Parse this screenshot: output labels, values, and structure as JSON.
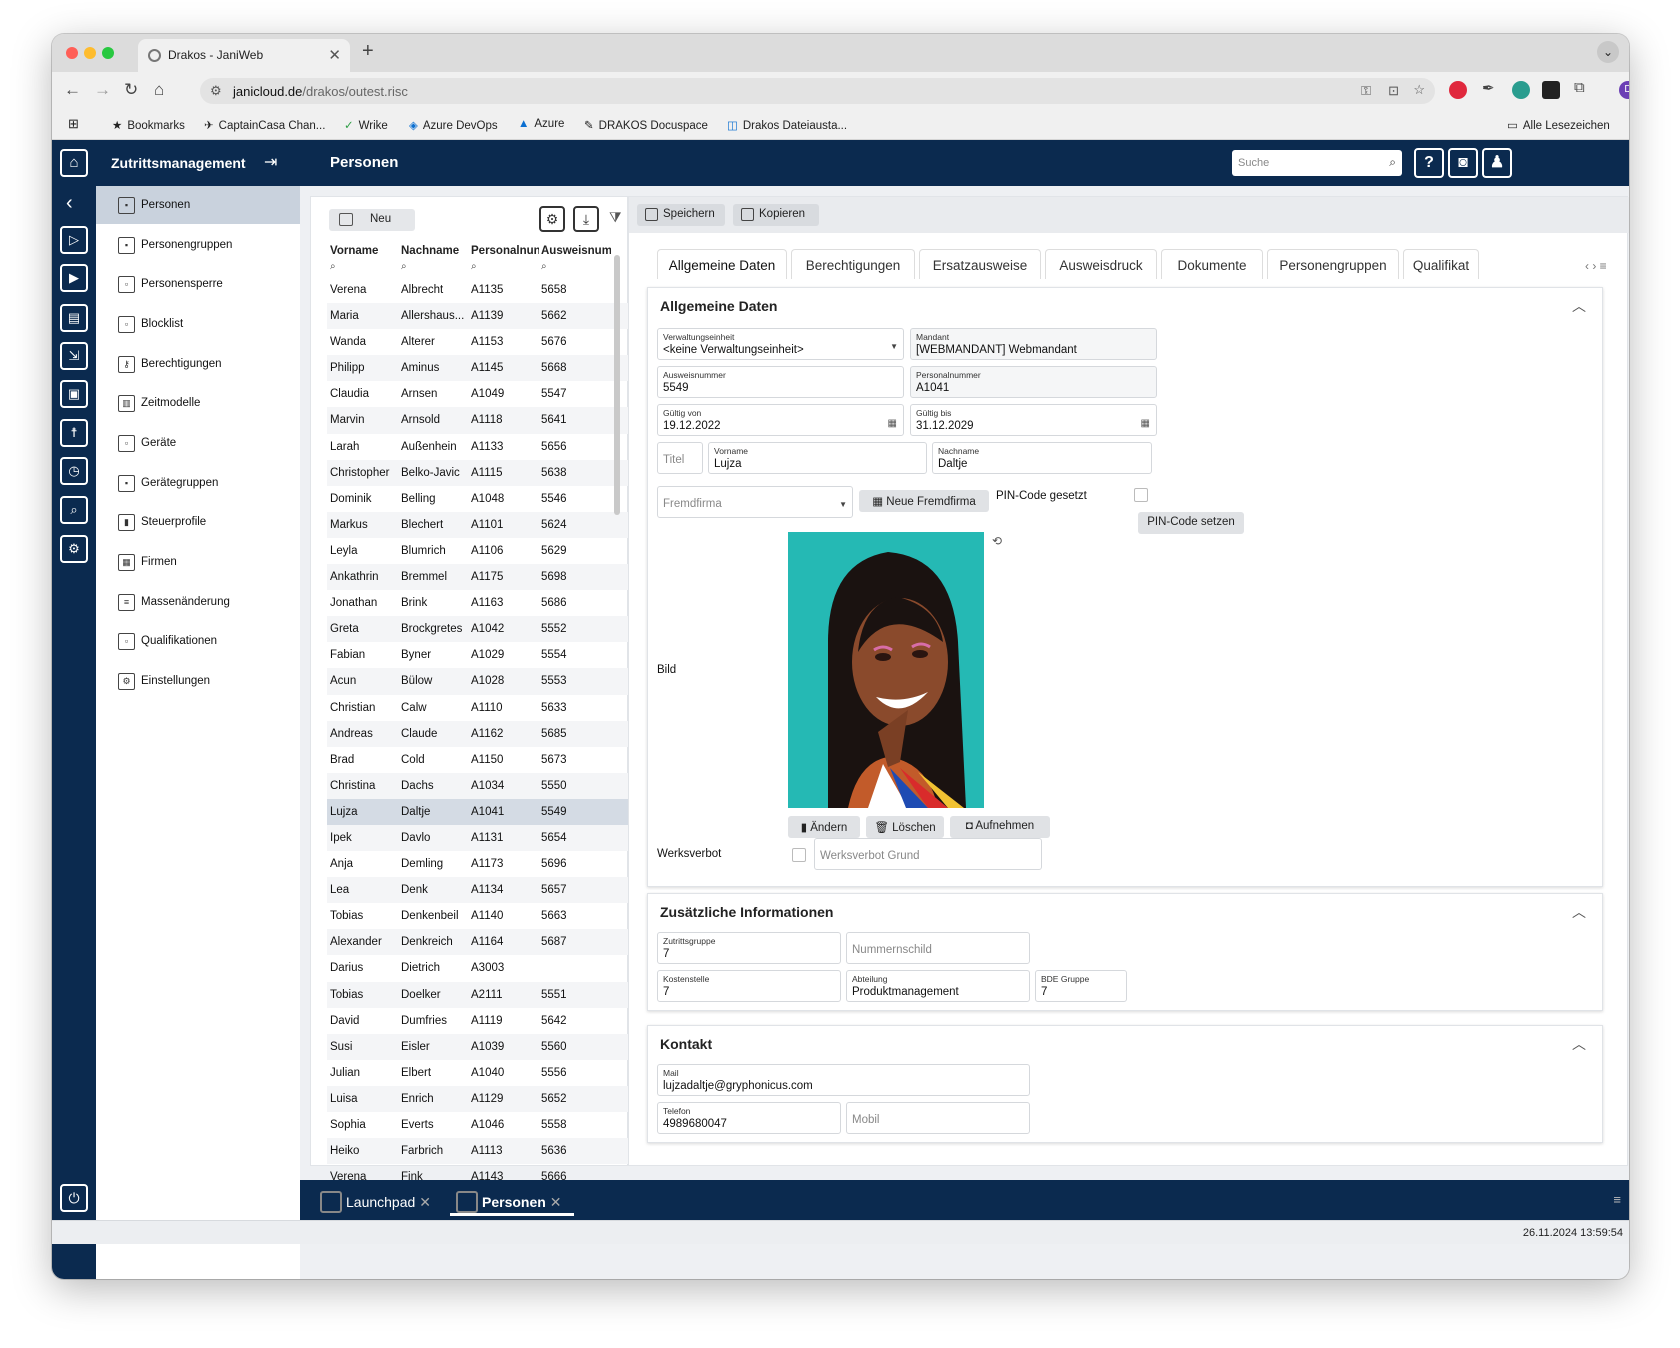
{
  "browser": {
    "tab_title": "Drakos - JaniWeb",
    "url_host": "janicloud.de",
    "url_path": "/drakos/outest.risc",
    "bookmarks": [
      "Bookmarks",
      "CaptainCasa Chan...",
      "Wrike",
      "Azure DevOps",
      "Azure",
      "DRAKOS Docuspace",
      "Drakos Dateiausta..."
    ],
    "all_bookmarks": "Alle Lesezeichen",
    "profile_initial": "D"
  },
  "app": {
    "title": "Zutrittsmanagement",
    "page_title": "Personen",
    "search_placeholder": "Suche",
    "help": "?"
  },
  "sidebar": {
    "items": [
      "Personen",
      "Personengruppen",
      "Personensperre",
      "Blocklist",
      "Berechtigungen",
      "Zeitmodelle",
      "Geräte",
      "Gerätegruppen",
      "Steuerprofile",
      "Firmen",
      "Massenänderung",
      "Qualifikationen",
      "Einstellungen"
    ]
  },
  "list": {
    "new_label": "Neu",
    "columns": [
      "Vorname",
      "Nachname",
      "Personalnun",
      "Ausweisnum"
    ],
    "rows": [
      [
        "Verena",
        "Albrecht",
        "A1135",
        "5658"
      ],
      [
        "Maria",
        "Allershaus...",
        "A1139",
        "5662"
      ],
      [
        "Wanda",
        "Alterer",
        "A1153",
        "5676"
      ],
      [
        "Philipp",
        "Aminus",
        "A1145",
        "5668"
      ],
      [
        "Claudia",
        "Arnsen",
        "A1049",
        "5547"
      ],
      [
        "Marvin",
        "Arnsold",
        "A1118",
        "5641"
      ],
      [
        "Larah",
        "Außenhein",
        "A1133",
        "5656"
      ],
      [
        "Christopher",
        "Belko-Javic",
        "A1115",
        "5638"
      ],
      [
        "Dominik",
        "Belling",
        "A1048",
        "5546"
      ],
      [
        "Markus",
        "Blechert",
        "A1101",
        "5624"
      ],
      [
        "Leyla",
        "Blumrich",
        "A1106",
        "5629"
      ],
      [
        "Ankathrin",
        "Bremmel",
        "A1175",
        "5698"
      ],
      [
        "Jonathan",
        "Brink",
        "A1163",
        "5686"
      ],
      [
        "Greta",
        "Brockgretes",
        "A1042",
        "5552"
      ],
      [
        "Fabian",
        "Byner",
        "A1029",
        "5554"
      ],
      [
        "Acun",
        "Bülow",
        "A1028",
        "5553"
      ],
      [
        "Christian",
        "Calw",
        "A1110",
        "5633"
      ],
      [
        "Andreas",
        "Claude",
        "A1162",
        "5685"
      ],
      [
        "Brad",
        "Cold",
        "A1150",
        "5673"
      ],
      [
        "Christina",
        "Dachs",
        "A1034",
        "5550"
      ],
      [
        "Lujza",
        "Daltje",
        "A1041",
        "5549"
      ],
      [
        "Ipek",
        "Davlo",
        "A1131",
        "5654"
      ],
      [
        "Anja",
        "Demling",
        "A1173",
        "5696"
      ],
      [
        "Lea",
        "Denk",
        "A1134",
        "5657"
      ],
      [
        "Tobias",
        "Denkenbeil",
        "A1140",
        "5663"
      ],
      [
        "Alexander",
        "Denkreich",
        "A1164",
        "5687"
      ],
      [
        "Darius",
        "Dietrich",
        "A3003",
        ""
      ],
      [
        "Tobias",
        "Doelker",
        "A2111",
        "5551"
      ],
      [
        "David",
        "Dumfries",
        "A1119",
        "5642"
      ],
      [
        "Susi",
        "Eisler",
        "A1039",
        "5560"
      ],
      [
        "Julian",
        "Elbert",
        "A1040",
        "5556"
      ],
      [
        "Luisa",
        "Enrich",
        "A1129",
        "5652"
      ],
      [
        "Sophia",
        "Everts",
        "A1046",
        "5558"
      ],
      [
        "Heiko",
        "Farbrich",
        "A1113",
        "5636"
      ],
      [
        "Verena",
        "Fink",
        "A1143",
        "5666"
      ]
    ]
  },
  "detail": {
    "save": "Speichern",
    "copy": "Kopieren",
    "tabs": [
      "Allgemeine Daten",
      "Berechtigungen",
      "Ersatzausweise",
      "Ausweisdruck",
      "Dokumente",
      "Personengruppen",
      "Qualifikat"
    ],
    "general": {
      "heading": "Allgemeine Daten",
      "verwaltung_label": "Verwaltungseinheit",
      "verwaltung_value": "<keine Verwaltungseinheit>",
      "mandant_label": "Mandant",
      "mandant_value": "[WEBMANDANT] Webmandant",
      "ausweis_label": "Ausweisnummer",
      "ausweis_value": "5549",
      "personal_label": "Personalnummer",
      "personal_value": "A1041",
      "gvon_label": "Gültig von",
      "gvon_value": "19.12.2022",
      "gbis_label": "Gültig bis",
      "gbis_value": "31.12.2029",
      "titel_ph": "Titel",
      "vorname_label": "Vorname",
      "vorname_value": "Lujza",
      "nachname_label": "Nachname",
      "nachname_value": "Daltje",
      "fremdfirma_ph": "Fremdfirma",
      "neue_fremdfirma": "Neue Fremdfirma",
      "pin_label": "PIN-Code gesetzt",
      "pin_button": "PIN-Code setzen",
      "bild_label": "Bild",
      "aendern": "Ändern",
      "loeschen": "Löschen",
      "aufnehmen": "Aufnehmen",
      "werksverbot_label": "Werksverbot",
      "werksverbot_grund_ph": "Werksverbot Grund"
    },
    "extra": {
      "heading": "Zusätzliche Informationen",
      "zutritt_label": "Zutrittsgruppe",
      "zutritt_value": "7",
      "nummernschild_ph": "Nummernschild",
      "kosten_label": "Kostenstelle",
      "kosten_value": "7",
      "abteilung_label": "Abteilung",
      "abteilung_value": "Produktmanagement",
      "bde_label": "BDE Gruppe",
      "bde_value": "7"
    },
    "contact": {
      "heading": "Kontakt",
      "mail_label": "Mail",
      "mail_value": "lujzadaltje@gryphonicus.com",
      "telefon_label": "Telefon",
      "telefon_value": "4989680047",
      "mobil_ph": "Mobil"
    }
  },
  "bottom": {
    "tabs": [
      "Launchpad",
      "Personen"
    ],
    "timestamp": "26.11.2024 13:59:54"
  },
  "colors": {
    "navy": "#0b2a4f",
    "selected_row": "#d4dbe4",
    "active_sidebar": "#c9d2dd"
  }
}
